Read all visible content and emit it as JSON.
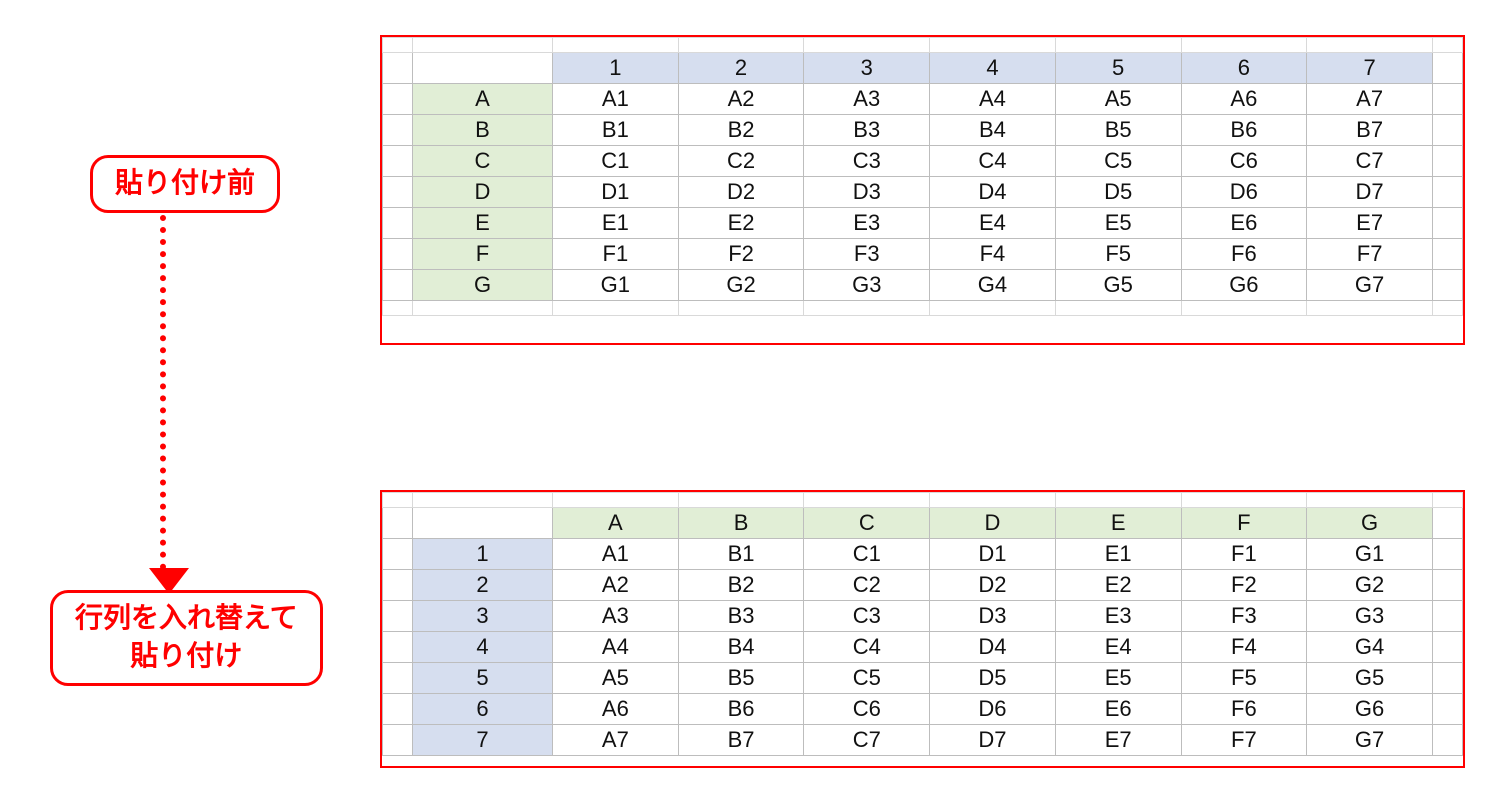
{
  "labels": {
    "before": "貼り付け前",
    "after_line1": "行列を入れ替えて",
    "after_line2": "貼り付け"
  },
  "table_before": {
    "col_headers": [
      "1",
      "2",
      "3",
      "4",
      "5",
      "6",
      "7"
    ],
    "row_headers": [
      "A",
      "B",
      "C",
      "D",
      "E",
      "F",
      "G"
    ],
    "rows": [
      [
        "A1",
        "A2",
        "A3",
        "A4",
        "A5",
        "A6",
        "A7"
      ],
      [
        "B1",
        "B2",
        "B3",
        "B4",
        "B5",
        "B6",
        "B7"
      ],
      [
        "C1",
        "C2",
        "C3",
        "C4",
        "C5",
        "C6",
        "C7"
      ],
      [
        "D1",
        "D2",
        "D3",
        "D4",
        "D5",
        "D6",
        "D7"
      ],
      [
        "E1",
        "E2",
        "E3",
        "E4",
        "E5",
        "E6",
        "E7"
      ],
      [
        "F1",
        "F2",
        "F3",
        "F4",
        "F5",
        "F6",
        "F7"
      ],
      [
        "G1",
        "G2",
        "G3",
        "G4",
        "G5",
        "G6",
        "G7"
      ]
    ]
  },
  "table_after": {
    "col_headers": [
      "A",
      "B",
      "C",
      "D",
      "E",
      "F",
      "G"
    ],
    "row_headers": [
      "1",
      "2",
      "3",
      "4",
      "5",
      "6",
      "7"
    ],
    "rows": [
      [
        "A1",
        "B1",
        "C1",
        "D1",
        "E1",
        "F1",
        "G1"
      ],
      [
        "A2",
        "B2",
        "C2",
        "D2",
        "E2",
        "F2",
        "G2"
      ],
      [
        "A3",
        "B3",
        "C3",
        "D3",
        "E3",
        "F3",
        "G3"
      ],
      [
        "A4",
        "B4",
        "C4",
        "D4",
        "E4",
        "F4",
        "G4"
      ],
      [
        "A5",
        "B5",
        "C5",
        "D5",
        "E5",
        "F5",
        "G5"
      ],
      [
        "A6",
        "B6",
        "C6",
        "D6",
        "E6",
        "F6",
        "G6"
      ],
      [
        "A7",
        "B7",
        "C7",
        "D7",
        "E7",
        "F7",
        "G7"
      ]
    ]
  },
  "colors": {
    "accent": "#ff0000",
    "numeric_header_bg": "#d6deef",
    "alpha_header_bg": "#e1eed6"
  }
}
